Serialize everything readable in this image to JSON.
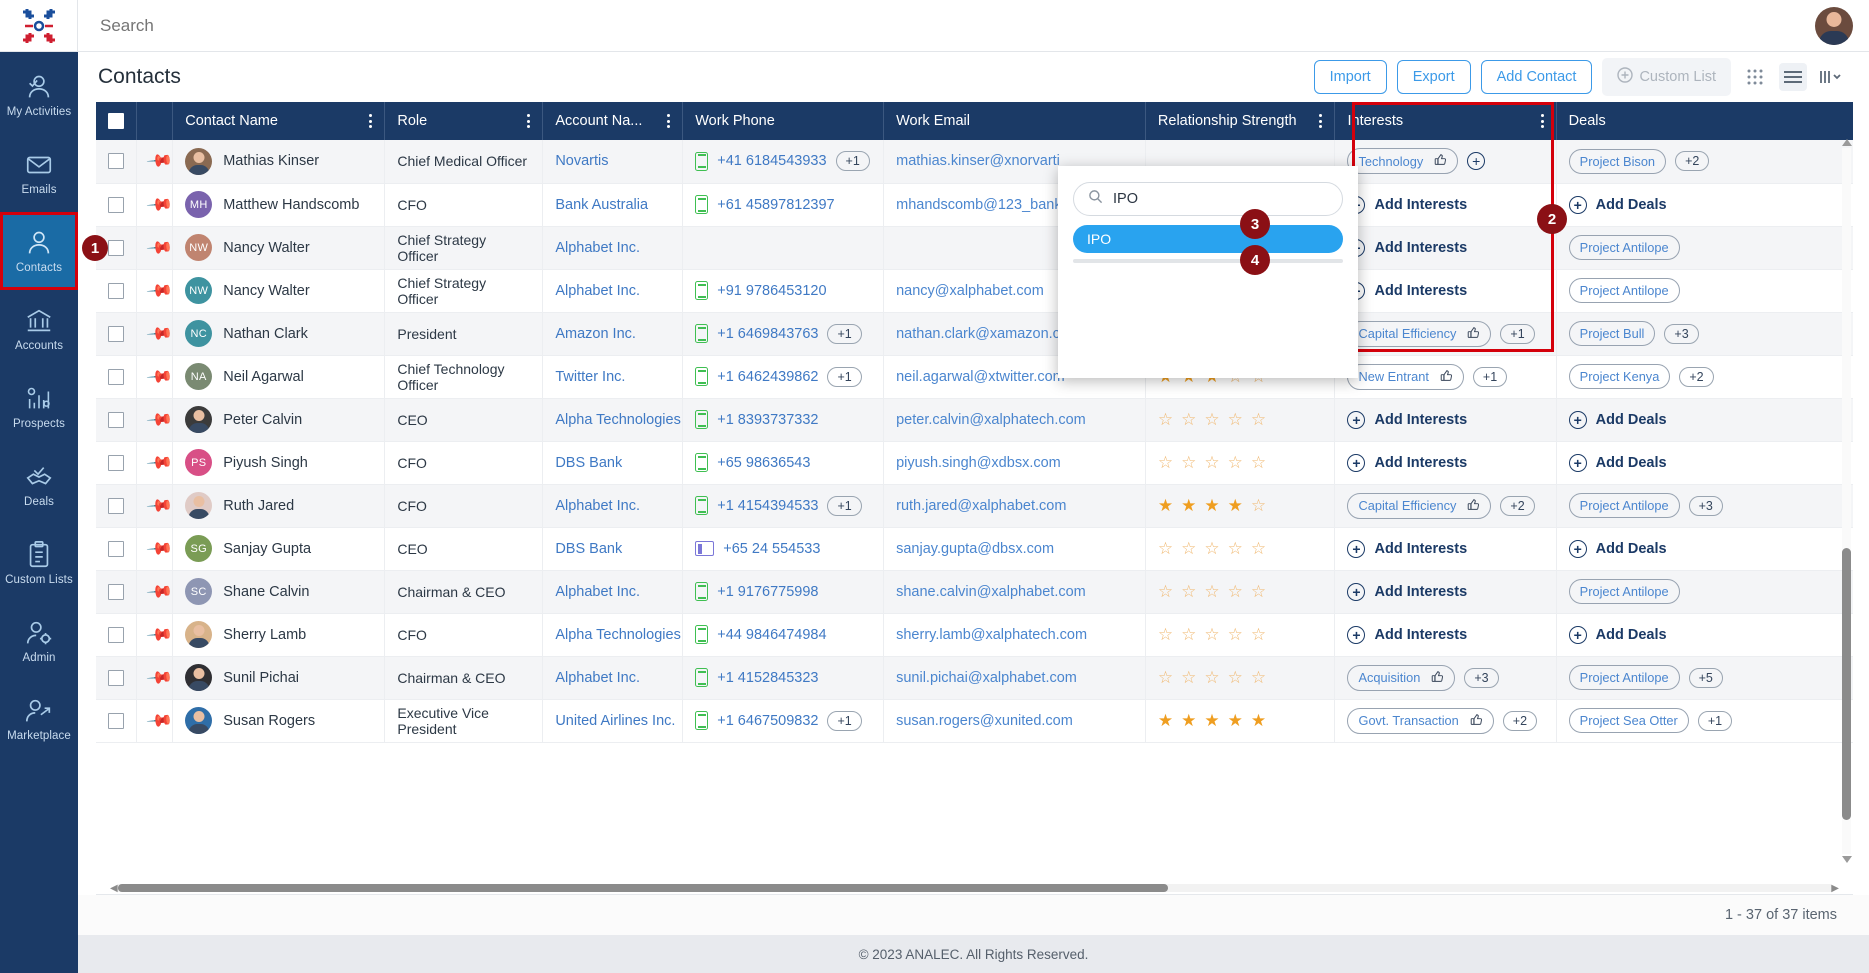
{
  "topbar": {
    "search_placeholder": "Search",
    "logo_name": "analec-logo"
  },
  "sidebar": {
    "items": [
      {
        "label": "My Activities",
        "icon": "user-check-icon"
      },
      {
        "label": "Emails",
        "icon": "envelope-icon"
      },
      {
        "label": "Contacts",
        "icon": "user-icon"
      },
      {
        "label": "Accounts",
        "icon": "bank-icon"
      },
      {
        "label": "Prospects",
        "icon": "chart-gear-icon"
      },
      {
        "label": "Deals",
        "icon": "handshake-check-icon"
      },
      {
        "label": "Custom Lists",
        "icon": "clipboard-list-icon"
      },
      {
        "label": "Admin",
        "icon": "user-gear-icon"
      },
      {
        "label": "Marketplace",
        "icon": "user-arrow-icon"
      }
    ]
  },
  "header": {
    "title": "Contacts",
    "buttons": {
      "import": "Import",
      "export": "Export",
      "add_contact": "Add Contact",
      "custom_list": "Custom List"
    }
  },
  "table": {
    "columns": [
      {
        "label": "Contact Name",
        "menu": true
      },
      {
        "label": "Role",
        "menu": true
      },
      {
        "label": "Account Na...",
        "menu": true
      },
      {
        "label": "Work Phone",
        "menu": false
      },
      {
        "label": "Work Email",
        "menu": false
      },
      {
        "label": "Relationship Strength",
        "menu": true
      },
      {
        "label": "Interests",
        "menu": true
      },
      {
        "label": "Deals",
        "menu": false
      }
    ],
    "add_interests_label": "Add Interests",
    "add_deals_label": "Add Deals",
    "rows": [
      {
        "name": "Mathias Kinser",
        "initials": "",
        "avatar_type": "photo",
        "avatar_color": "#8a6a52",
        "role": "Chief Medical Officer",
        "account": "Novartis",
        "phone": "+41 6184543933",
        "phone_type": "mobile",
        "phone_more": "+1",
        "email": "mathias.kinser@xnorvarti",
        "stars": 0,
        "stars_shown": false,
        "interests": [
          {
            "label": "Technology"
          }
        ],
        "interests_more": "",
        "interests_plus_icon": true,
        "deals": [
          {
            "label": "Project Bison"
          }
        ],
        "deals_more": "+2"
      },
      {
        "name": "Matthew Handscomb",
        "initials": "MH",
        "avatar_type": "initials",
        "avatar_color": "#7a63ad",
        "role": "CFO",
        "account": "Bank Australia",
        "phone": "+61 45897812397",
        "phone_type": "mobile",
        "phone_more": "",
        "email": "mhandscomb@123_bank",
        "stars": 0,
        "stars_shown": false,
        "interests": [],
        "interests_more": "",
        "interests_plus_icon": false,
        "deals": [],
        "deals_more": ""
      },
      {
        "name": "Nancy Walter",
        "initials": "NW",
        "avatar_type": "initials",
        "avatar_color": "#c08470",
        "role": "Chief Strategy Officer",
        "account": "Alphabet Inc.",
        "phone": "",
        "phone_type": "none",
        "phone_more": "",
        "email": "",
        "stars": 0,
        "stars_shown": false,
        "interests": [],
        "interests_more": "",
        "interests_plus_icon": false,
        "deals": [
          {
            "label": "Project Antilope"
          }
        ],
        "deals_more": ""
      },
      {
        "name": "Nancy Walter",
        "initials": "NW",
        "avatar_type": "initials",
        "avatar_color": "#3e93a0",
        "role": "Chief Strategy Officer",
        "account": "Alphabet Inc.",
        "phone": "+91 9786453120",
        "phone_type": "mobile",
        "phone_more": "",
        "email": "nancy@xalphabet.com",
        "stars": 0,
        "stars_shown": false,
        "interests": [],
        "interests_more": "",
        "interests_plus_icon": false,
        "deals": [
          {
            "label": "Project Antilope"
          }
        ],
        "deals_more": ""
      },
      {
        "name": "Nathan Clark",
        "initials": "NC",
        "avatar_type": "initials",
        "avatar_color": "#3e93a0",
        "role": "President",
        "account": "Amazon Inc.",
        "phone": "+1 6469843763",
        "phone_type": "mobile",
        "phone_more": "+1",
        "email": "nathan.clark@xamazon.co",
        "stars": 0,
        "stars_shown": false,
        "interests": [
          {
            "label": "Capital Efficiency"
          }
        ],
        "interests_more": "+1",
        "interests_plus_icon": false,
        "deals": [
          {
            "label": "Project Bull"
          }
        ],
        "deals_more": "+3"
      },
      {
        "name": "Neil Agarwal",
        "initials": "NA",
        "avatar_type": "initials",
        "avatar_color": "#7a8a72",
        "role": "Chief Technology Officer",
        "account": "Twitter Inc.",
        "phone": "+1 6462439862",
        "phone_type": "mobile",
        "phone_more": "+1",
        "email": "neil.agarwal@xtwitter.com",
        "stars": 3,
        "stars_shown": true,
        "interests": [
          {
            "label": "New Entrant"
          }
        ],
        "interests_more": "+1",
        "interests_plus_icon": false,
        "deals": [
          {
            "label": "Project Kenya"
          }
        ],
        "deals_more": "+2"
      },
      {
        "name": "Peter Calvin",
        "initials": "",
        "avatar_type": "photo",
        "avatar_color": "#3b3b3b",
        "role": "CEO",
        "account": "Alpha Technologies",
        "phone": "+1 8393737332",
        "phone_type": "mobile",
        "phone_more": "",
        "email": "peter.calvin@xalphatech.com",
        "stars": 0,
        "stars_shown": true,
        "interests": [],
        "interests_more": "",
        "interests_plus_icon": false,
        "deals": [],
        "deals_more": ""
      },
      {
        "name": "Piyush Singh",
        "initials": "PS",
        "avatar_type": "initials",
        "avatar_color": "#d84f86",
        "role": "CFO",
        "account": "DBS Bank",
        "phone": "+65 98636543",
        "phone_type": "mobile",
        "phone_more": "",
        "email": "piyush.singh@xdbsx.com",
        "stars": 0,
        "stars_shown": true,
        "interests": [],
        "interests_more": "",
        "interests_plus_icon": false,
        "deals": [],
        "deals_more": ""
      },
      {
        "name": "Ruth Jared",
        "initials": "",
        "avatar_type": "photo",
        "avatar_color": "#e0cbc6",
        "role": "CFO",
        "account": "Alphabet Inc.",
        "phone": "+1 4154394533",
        "phone_type": "mobile",
        "phone_more": "+1",
        "email": "ruth.jared@xalphabet.com",
        "stars": 4,
        "stars_shown": true,
        "interests": [
          {
            "label": "Capital Efficiency"
          }
        ],
        "interests_more": "+2",
        "interests_plus_icon": false,
        "deals": [
          {
            "label": "Project Antilope"
          }
        ],
        "deals_more": "+3"
      },
      {
        "name": "Sanjay Gupta",
        "initials": "SG",
        "avatar_type": "initials",
        "avatar_color": "#7a9c55",
        "role": "CEO",
        "account": "DBS Bank",
        "phone": "+65 24 554533",
        "phone_type": "telephone",
        "phone_more": "",
        "email": "sanjay.gupta@dbsx.com",
        "stars": 0,
        "stars_shown": true,
        "interests": [],
        "interests_more": "",
        "interests_plus_icon": false,
        "deals": [],
        "deals_more": ""
      },
      {
        "name": "Shane Calvin",
        "initials": "SC",
        "avatar_type": "initials",
        "avatar_color": "#8e96b3",
        "role": "Chairman & CEO",
        "account": "Alphabet Inc.",
        "phone": "+1 9176775998",
        "phone_type": "mobile",
        "phone_more": "",
        "email": "shane.calvin@xalphabet.com",
        "stars": 0,
        "stars_shown": true,
        "interests": [],
        "interests_more": "",
        "interests_plus_icon": false,
        "deals": [
          {
            "label": "Project Antilope"
          }
        ],
        "deals_more": ""
      },
      {
        "name": "Sherry Lamb",
        "initials": "",
        "avatar_type": "photo",
        "avatar_color": "#d8b38a",
        "role": "CFO",
        "account": "Alpha Technologies",
        "phone": "+44 9846474984",
        "phone_type": "mobile",
        "phone_more": "",
        "email": "sherry.lamb@xalphatech.com",
        "stars": 0,
        "stars_shown": true,
        "interests": [],
        "interests_more": "",
        "interests_plus_icon": false,
        "deals": [],
        "deals_more": ""
      },
      {
        "name": "Sunil Pichai",
        "initials": "",
        "avatar_type": "photo",
        "avatar_color": "#2f2f33",
        "role": "Chairman & CEO",
        "account": "Alphabet Inc.",
        "phone": "+1 4152845323",
        "phone_type": "mobile",
        "phone_more": "",
        "email": "sunil.pichai@xalphabet.com",
        "stars": 0,
        "stars_shown": true,
        "interests": [
          {
            "label": "Acquisition"
          }
        ],
        "interests_more": "+3",
        "interests_plus_icon": false,
        "deals": [
          {
            "label": "Project Antilope"
          }
        ],
        "deals_more": "+5"
      },
      {
        "name": "Susan Rogers",
        "initials": "",
        "avatar_type": "photo",
        "avatar_color": "#2f6ea8",
        "role": "Executive Vice President",
        "account": "United Airlines Inc.",
        "phone": "+1 6467509832",
        "phone_type": "mobile",
        "phone_more": "+1",
        "email": "susan.rogers@xunited.com",
        "stars": 5,
        "stars_shown": true,
        "interests": [
          {
            "label": "Govt. Transaction"
          }
        ],
        "interests_more": "+2",
        "interests_plus_icon": false,
        "deals": [
          {
            "label": "Project Sea Otter"
          }
        ],
        "deals_more": "+1"
      }
    ]
  },
  "popup": {
    "search_value": "IPO",
    "search_placeholder": "",
    "options": [
      "IPO"
    ]
  },
  "callouts": [
    {
      "number": "1",
      "target": "sidebar-contacts"
    },
    {
      "number": "2",
      "target": "interests-column"
    },
    {
      "number": "3",
      "target": "popup-search"
    },
    {
      "number": "4",
      "target": "popup-option-ipo"
    }
  ],
  "footer": {
    "pagination": "1 - 37 of 37 items",
    "copyright": "© 2023 ANALEC. All Rights Reserved."
  },
  "colors": {
    "sidebar_bg": "#1b3a66",
    "accent": "#3c9ae8",
    "highlight_red": "#d4000b",
    "selected_blue": "#29a3ef",
    "star": "#ef9e20"
  }
}
